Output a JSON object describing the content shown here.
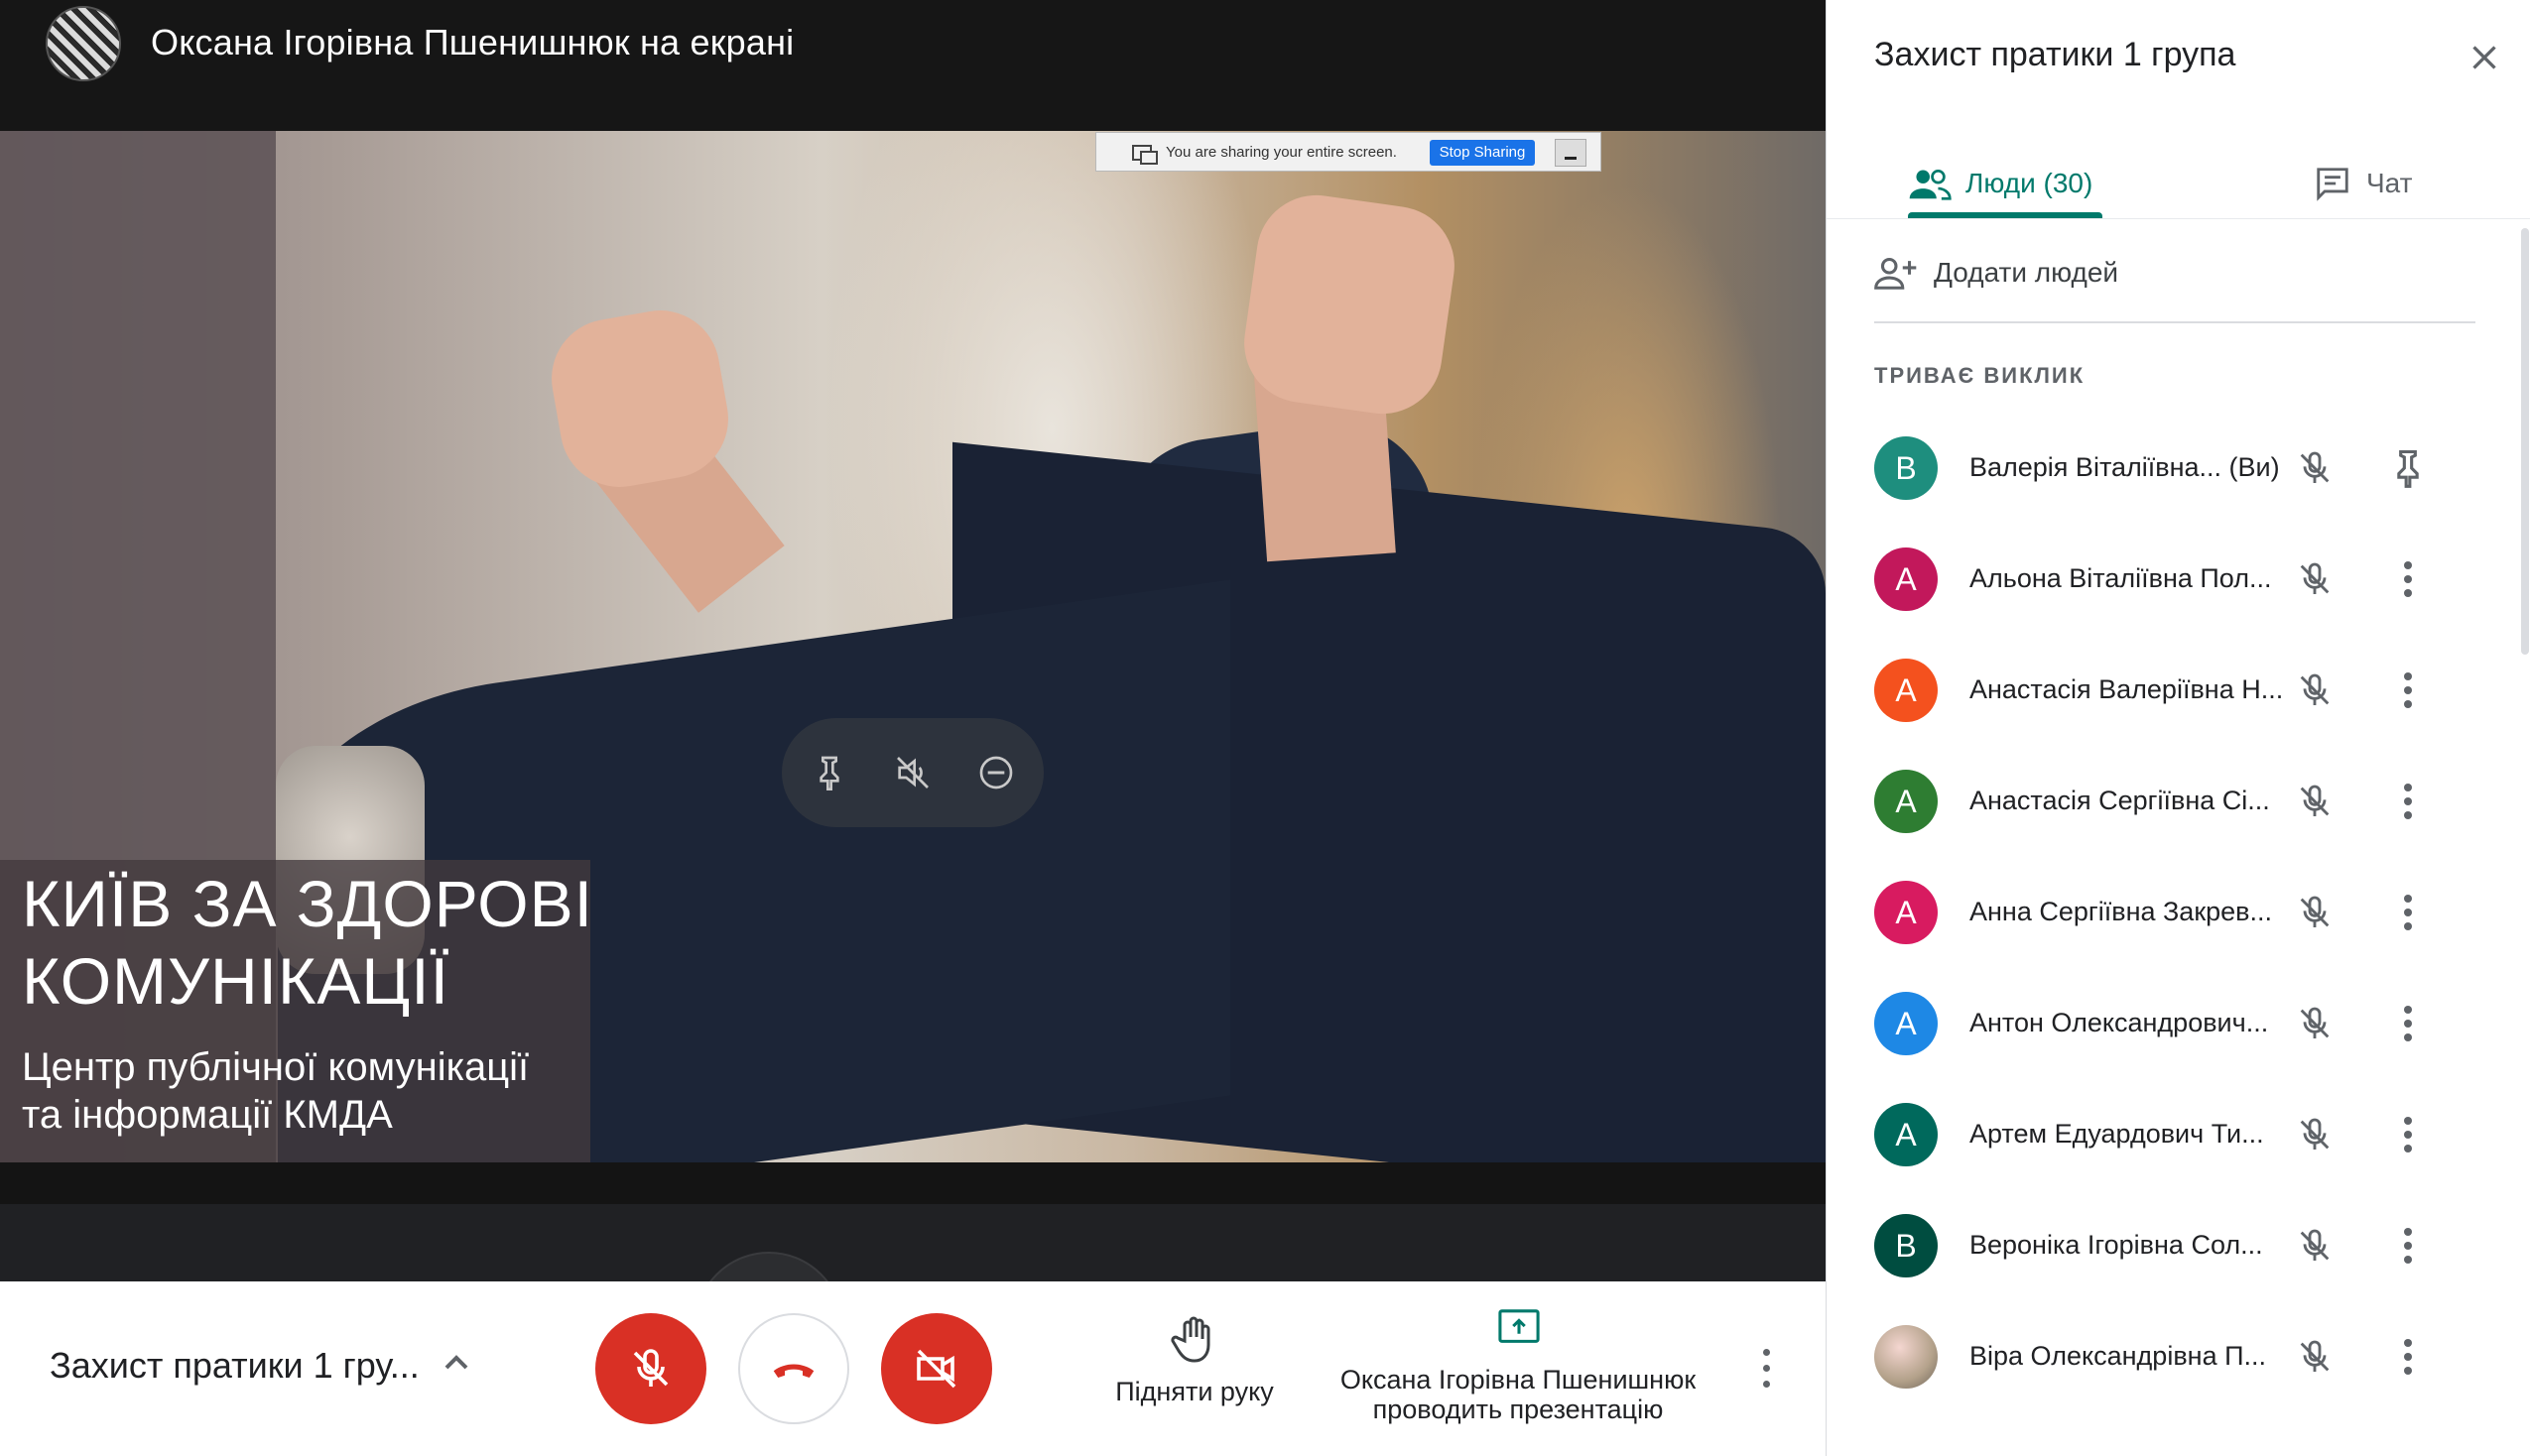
{
  "presenter": {
    "title": "Оксана Ігорівна Пшенишнюк на екрані"
  },
  "screen_share": {
    "notice": "You are sharing your entire screen.",
    "stop_label": "Stop Sharing"
  },
  "slide": {
    "title_line1": "КИЇВ ЗА ЗДОРОВІ",
    "title_line2": "КОМУНІКАЦІЇ",
    "subtitle_line1": "Центр публічної комунікації",
    "subtitle_line2": "та інформації КМДА"
  },
  "controls": {
    "meeting_name": "Захист пратики 1 гру...",
    "raise_hand_label": "Підняти руку",
    "presenting_line1": "Оксана Ігорівна Пшенишнюк",
    "presenting_line2": "проводить презентацію"
  },
  "panel": {
    "title": "Захист пратики 1 група",
    "tab_people": "Люди (30)",
    "tab_chat": "Чат",
    "add_people": "Додати людей",
    "section": "ТРИВАЄ ВИКЛИК",
    "people": [
      {
        "initial": "В",
        "name": "Валерія Віталіївна...",
        "suffix": "(Ви)",
        "color": "#1e8e7e",
        "action": "pin-icon"
      },
      {
        "initial": "А",
        "name": "Альона Віталіївна Пол...",
        "suffix": "",
        "color": "#c2185b",
        "action": "more-icon"
      },
      {
        "initial": "А",
        "name": "Анастасія Валеріївна Н...",
        "suffix": "",
        "color": "#f4511e",
        "action": "more-icon"
      },
      {
        "initial": "А",
        "name": "Анастасія Сергіївна Сі...",
        "suffix": "",
        "color": "#2e7d32",
        "action": "more-icon"
      },
      {
        "initial": "А",
        "name": "Анна Сергіївна Закрев...",
        "suffix": "",
        "color": "#d81b60",
        "action": "more-icon"
      },
      {
        "initial": "А",
        "name": "Антон Олександрович...",
        "suffix": "",
        "color": "#1e88e5",
        "action": "more-icon"
      },
      {
        "initial": "А",
        "name": "Артем Едуардович Ти...",
        "suffix": "",
        "color": "#00695c",
        "action": "more-icon"
      },
      {
        "initial": "В",
        "name": "Вероніка Ігорівна Сол...",
        "suffix": "",
        "color": "#004d40",
        "action": "more-icon"
      },
      {
        "initial": "",
        "name": "Віра Олександрівна П...",
        "suffix": "",
        "color": "#9e9e9e",
        "action": "more-icon"
      }
    ]
  }
}
